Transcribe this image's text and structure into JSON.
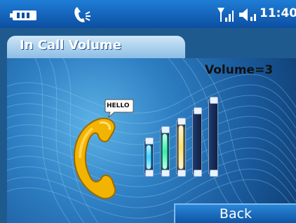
{
  "status_bar": {
    "time": "11:40",
    "icons": [
      "battery-icon",
      "call-forward-icon",
      "signal-icon",
      "speaker-icon"
    ]
  },
  "title": "In Call Volume",
  "volume": {
    "label": "Volume=3",
    "level": 3,
    "max": 5
  },
  "illustration": {
    "bubble_text": "HELLO"
  },
  "softkeys": {
    "right": "Back"
  },
  "colors": {
    "status_bar": "#1f7dd6",
    "background": "#1a5b9d",
    "title_tab": "#7fb6e1",
    "bar_glow_1": "#37d0ff",
    "bar_glow_2": "#35f0a7",
    "bar_glow_3": "#ffe26b"
  }
}
